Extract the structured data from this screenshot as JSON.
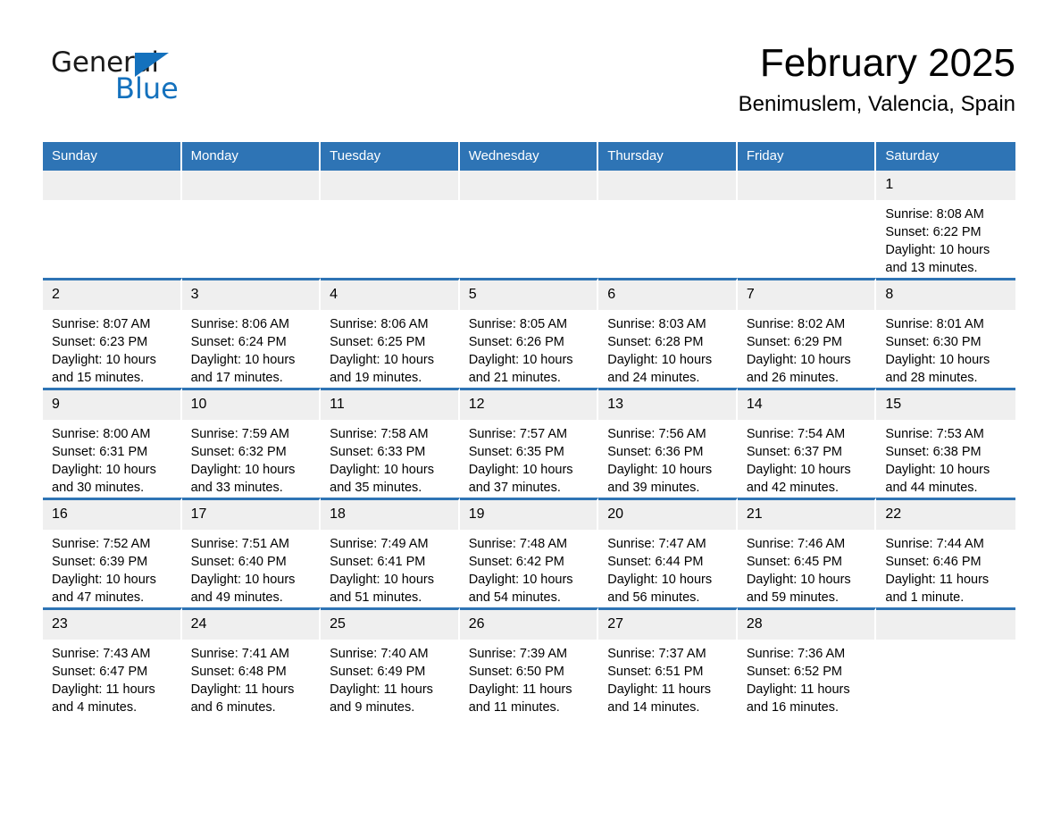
{
  "brand": {
    "name_part1": "General",
    "name_part2": "Blue",
    "accent_color": "#1471bd"
  },
  "header": {
    "title": "February 2025",
    "subtitle": "Benimuslem, Valencia, Spain"
  },
  "calendar": {
    "header_bg": "#2e74b5",
    "daynum_bg": "#efefef",
    "weekday_headers": [
      "Sunday",
      "Monday",
      "Tuesday",
      "Wednesday",
      "Thursday",
      "Friday",
      "Saturday"
    ],
    "weeks": [
      [
        {
          "day": "",
          "sunrise": "",
          "sunset": "",
          "daylight": ""
        },
        {
          "day": "",
          "sunrise": "",
          "sunset": "",
          "daylight": ""
        },
        {
          "day": "",
          "sunrise": "",
          "sunset": "",
          "daylight": ""
        },
        {
          "day": "",
          "sunrise": "",
          "sunset": "",
          "daylight": ""
        },
        {
          "day": "",
          "sunrise": "",
          "sunset": "",
          "daylight": ""
        },
        {
          "day": "",
          "sunrise": "",
          "sunset": "",
          "daylight": ""
        },
        {
          "day": "1",
          "sunrise": "Sunrise: 8:08 AM",
          "sunset": "Sunset: 6:22 PM",
          "daylight": "Daylight: 10 hours and 13 minutes."
        }
      ],
      [
        {
          "day": "2",
          "sunrise": "Sunrise: 8:07 AM",
          "sunset": "Sunset: 6:23 PM",
          "daylight": "Daylight: 10 hours and 15 minutes."
        },
        {
          "day": "3",
          "sunrise": "Sunrise: 8:06 AM",
          "sunset": "Sunset: 6:24 PM",
          "daylight": "Daylight: 10 hours and 17 minutes."
        },
        {
          "day": "4",
          "sunrise": "Sunrise: 8:06 AM",
          "sunset": "Sunset: 6:25 PM",
          "daylight": "Daylight: 10 hours and 19 minutes."
        },
        {
          "day": "5",
          "sunrise": "Sunrise: 8:05 AM",
          "sunset": "Sunset: 6:26 PM",
          "daylight": "Daylight: 10 hours and 21 minutes."
        },
        {
          "day": "6",
          "sunrise": "Sunrise: 8:03 AM",
          "sunset": "Sunset: 6:28 PM",
          "daylight": "Daylight: 10 hours and 24 minutes."
        },
        {
          "day": "7",
          "sunrise": "Sunrise: 8:02 AM",
          "sunset": "Sunset: 6:29 PM",
          "daylight": "Daylight: 10 hours and 26 minutes."
        },
        {
          "day": "8",
          "sunrise": "Sunrise: 8:01 AM",
          "sunset": "Sunset: 6:30 PM",
          "daylight": "Daylight: 10 hours and 28 minutes."
        }
      ],
      [
        {
          "day": "9",
          "sunrise": "Sunrise: 8:00 AM",
          "sunset": "Sunset: 6:31 PM",
          "daylight": "Daylight: 10 hours and 30 minutes."
        },
        {
          "day": "10",
          "sunrise": "Sunrise: 7:59 AM",
          "sunset": "Sunset: 6:32 PM",
          "daylight": "Daylight: 10 hours and 33 minutes."
        },
        {
          "day": "11",
          "sunrise": "Sunrise: 7:58 AM",
          "sunset": "Sunset: 6:33 PM",
          "daylight": "Daylight: 10 hours and 35 minutes."
        },
        {
          "day": "12",
          "sunrise": "Sunrise: 7:57 AM",
          "sunset": "Sunset: 6:35 PM",
          "daylight": "Daylight: 10 hours and 37 minutes."
        },
        {
          "day": "13",
          "sunrise": "Sunrise: 7:56 AM",
          "sunset": "Sunset: 6:36 PM",
          "daylight": "Daylight: 10 hours and 39 minutes."
        },
        {
          "day": "14",
          "sunrise": "Sunrise: 7:54 AM",
          "sunset": "Sunset: 6:37 PM",
          "daylight": "Daylight: 10 hours and 42 minutes."
        },
        {
          "day": "15",
          "sunrise": "Sunrise: 7:53 AM",
          "sunset": "Sunset: 6:38 PM",
          "daylight": "Daylight: 10 hours and 44 minutes."
        }
      ],
      [
        {
          "day": "16",
          "sunrise": "Sunrise: 7:52 AM",
          "sunset": "Sunset: 6:39 PM",
          "daylight": "Daylight: 10 hours and 47 minutes."
        },
        {
          "day": "17",
          "sunrise": "Sunrise: 7:51 AM",
          "sunset": "Sunset: 6:40 PM",
          "daylight": "Daylight: 10 hours and 49 minutes."
        },
        {
          "day": "18",
          "sunrise": "Sunrise: 7:49 AM",
          "sunset": "Sunset: 6:41 PM",
          "daylight": "Daylight: 10 hours and 51 minutes."
        },
        {
          "day": "19",
          "sunrise": "Sunrise: 7:48 AM",
          "sunset": "Sunset: 6:42 PM",
          "daylight": "Daylight: 10 hours and 54 minutes."
        },
        {
          "day": "20",
          "sunrise": "Sunrise: 7:47 AM",
          "sunset": "Sunset: 6:44 PM",
          "daylight": "Daylight: 10 hours and 56 minutes."
        },
        {
          "day": "21",
          "sunrise": "Sunrise: 7:46 AM",
          "sunset": "Sunset: 6:45 PM",
          "daylight": "Daylight: 10 hours and 59 minutes."
        },
        {
          "day": "22",
          "sunrise": "Sunrise: 7:44 AM",
          "sunset": "Sunset: 6:46 PM",
          "daylight": "Daylight: 11 hours and 1 minute."
        }
      ],
      [
        {
          "day": "23",
          "sunrise": "Sunrise: 7:43 AM",
          "sunset": "Sunset: 6:47 PM",
          "daylight": "Daylight: 11 hours and 4 minutes."
        },
        {
          "day": "24",
          "sunrise": "Sunrise: 7:41 AM",
          "sunset": "Sunset: 6:48 PM",
          "daylight": "Daylight: 11 hours and 6 minutes."
        },
        {
          "day": "25",
          "sunrise": "Sunrise: 7:40 AM",
          "sunset": "Sunset: 6:49 PM",
          "daylight": "Daylight: 11 hours and 9 minutes."
        },
        {
          "day": "26",
          "sunrise": "Sunrise: 7:39 AM",
          "sunset": "Sunset: 6:50 PM",
          "daylight": "Daylight: 11 hours and 11 minutes."
        },
        {
          "day": "27",
          "sunrise": "Sunrise: 7:37 AM",
          "sunset": "Sunset: 6:51 PM",
          "daylight": "Daylight: 11 hours and 14 minutes."
        },
        {
          "day": "28",
          "sunrise": "Sunrise: 7:36 AM",
          "sunset": "Sunset: 6:52 PM",
          "daylight": "Daylight: 11 hours and 16 minutes."
        },
        {
          "day": "",
          "sunrise": "",
          "sunset": "",
          "daylight": ""
        }
      ]
    ]
  }
}
